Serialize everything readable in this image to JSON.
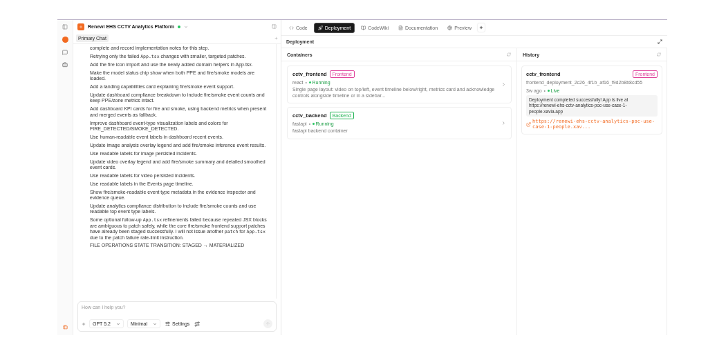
{
  "project": {
    "title": "Renewi EHS CCTV Analytics Platform",
    "online": true
  },
  "chat_tabs": [
    {
      "label": "Primary Chat",
      "selected": true
    }
  ],
  "messages": [
    {
      "parts": [
        {
          "kind": "text",
          "text": "complete and record implementation notes for this step."
        }
      ]
    },
    {
      "parts": [
        {
          "kind": "text",
          "text": "Retrying only the failed "
        },
        {
          "kind": "code",
          "text": "App.tsx"
        },
        {
          "kind": "text",
          "text": " changes with smaller, targeted patches."
        }
      ]
    },
    {
      "parts": [
        {
          "kind": "text",
          "text": "Add the fire icon import and use the newly added domain helpers in App.tsx."
        }
      ]
    },
    {
      "parts": [
        {
          "kind": "text",
          "text": "Make the model status chip show when both PPE and fire/smoke models are loaded."
        }
      ]
    },
    {
      "parts": [
        {
          "kind": "text",
          "text": "Add a landing capabilities card explaining fire/smoke event support."
        }
      ]
    },
    {
      "parts": [
        {
          "kind": "text",
          "text": "Update dashboard compliance breakdown to include fire/smoke event counts and keep PPE/zone metrics intact."
        }
      ]
    },
    {
      "parts": [
        {
          "kind": "text",
          "text": "Add dashboard KPI cards for fire and smoke, using backend metrics when present and merged events as fallback."
        }
      ]
    },
    {
      "parts": [
        {
          "kind": "text",
          "text": "Improve dashboard event-type visualization labels and colors for FIRE_DETECTED/SMOKE_DETECTED."
        }
      ]
    },
    {
      "parts": [
        {
          "kind": "text",
          "text": "Use human-readable event labels in dashboard recent events."
        }
      ]
    },
    {
      "parts": [
        {
          "kind": "text",
          "text": "Update image analysis overlay legend and add fire/smoke inference event results."
        }
      ]
    },
    {
      "parts": [
        {
          "kind": "text",
          "text": "Use readable labels for image persisted incidents."
        }
      ]
    },
    {
      "parts": [
        {
          "kind": "text",
          "text": "Update video overlay legend and add fire/smoke summary and detailed smoothed event cards."
        }
      ]
    },
    {
      "parts": [
        {
          "kind": "text",
          "text": "Use readable labels for video persisted incidents."
        }
      ]
    },
    {
      "parts": [
        {
          "kind": "text",
          "text": "Use readable labels in the Events page timeline."
        }
      ]
    },
    {
      "parts": [
        {
          "kind": "text",
          "text": "Show fire/smoke-readable event type metadata in the evidence inspector and evidence queue."
        }
      ]
    },
    {
      "parts": [
        {
          "kind": "text",
          "text": "Update analytics compliance distribution to include fire/smoke counts and use readable top event type labels."
        }
      ]
    },
    {
      "parts": [
        {
          "kind": "text",
          "text": "Some optional follow-up "
        },
        {
          "kind": "code",
          "text": "App.tsx"
        },
        {
          "kind": "text",
          "text": " refinements failed because repeated JSX blocks are ambiguous to patch safely, while the core fire/smoke frontend support patches have already been staged successfully. I will not issue another "
        },
        {
          "kind": "code",
          "text": "patch"
        },
        {
          "kind": "text",
          "text": " for "
        },
        {
          "kind": "code",
          "text": "App.tsx"
        },
        {
          "kind": "text",
          "text": " due to the patch failure rate-limit instruction."
        }
      ]
    },
    {
      "parts": [
        {
          "kind": "text",
          "text": "FILE OPERATIONS STATE TRANSITION: STAGED → MATERIALIZED"
        }
      ]
    }
  ],
  "composer": {
    "placeholder": "How can I help you?",
    "model": "GPT 5.2",
    "effort": "Minimal",
    "settings": "Settings"
  },
  "tabs": [
    {
      "label": "Code",
      "selected": false
    },
    {
      "label": "Deployment",
      "selected": true
    },
    {
      "label": "CodeWiki",
      "selected": false
    },
    {
      "label": "Documentation",
      "selected": false
    },
    {
      "label": "Preview",
      "selected": false
    }
  ],
  "section_title": "Deployment",
  "containers": {
    "title": "Containers",
    "items": [
      {
        "name": "cctv_frontend",
        "tag": "Frontend",
        "color": "#e0409a",
        "framework": "react",
        "separator": "•",
        "status": "Running",
        "description": "Single page layout: video on top/left, event timeline below/right, metrics card and acknowledge controls alongside timeline or in a sidebar..."
      },
      {
        "name": "cctv_backend",
        "tag": "Backend",
        "color": "#22b455",
        "framework": "fastapi",
        "separator": "•",
        "status": "Running",
        "description": "fastapi backend container"
      }
    ]
  },
  "history": {
    "title": "History",
    "items": [
      {
        "name": "cctv_frontend",
        "tag": "Frontend",
        "color": "#e0409a",
        "id": "frontend_deployment_2c26_4f1b_af16_f9d2b8b8cd55",
        "age": "3w ago",
        "separator": "•",
        "status": "Live",
        "message": "Deployment completed successfully! App is live at https://renewi-ehs-cctv-analytics-poc-use-case-1-people.xavia.app",
        "url": "https://renewi-ehs-cctv-analytics-poc-use-case-1-people.xav..."
      }
    ]
  }
}
